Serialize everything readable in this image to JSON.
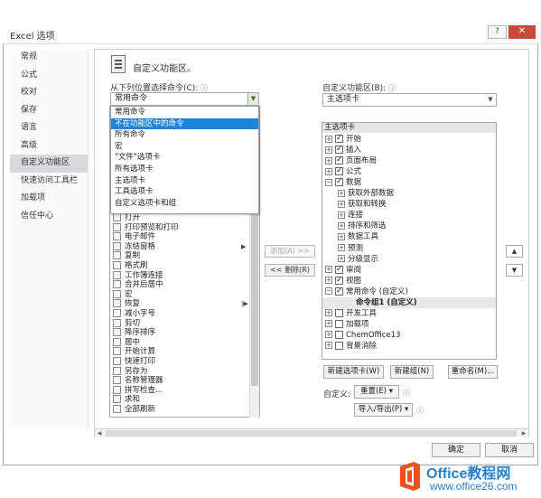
{
  "window": {
    "title": "Excel 选项",
    "help_label": "?",
    "close_label": "✕"
  },
  "nav": [
    "常规",
    "公式",
    "校对",
    "保存",
    "语言",
    "高级",
    "自定义功能区",
    "快速访问工具栏",
    "加载项",
    "信任中心"
  ],
  "nav_active_index": 6,
  "header": {
    "title": "自定义功能区。"
  },
  "left": {
    "label": "从下列位置选择命令(C):",
    "combo_value": "常用命令",
    "dropdown": [
      "常用命令",
      "不在功能区中的命令",
      "所有命令",
      "宏",
      "\"文件\"选项卡",
      "所有选项卡",
      "主选项卡",
      "工具选项卡",
      "自定义选项卡和组"
    ],
    "dropdown_selected_index": 1,
    "commands": [
      {
        "label": "打开",
        "sub": ""
      },
      {
        "label": "打印预览和打印",
        "sub": ""
      },
      {
        "label": "电子邮件",
        "sub": ""
      },
      {
        "label": "冻结窗格",
        "sub": "▶"
      },
      {
        "label": "复制",
        "sub": ""
      },
      {
        "label": "格式刷",
        "sub": ""
      },
      {
        "label": "工作簿连接",
        "sub": ""
      },
      {
        "label": "合并后居中",
        "sub": ""
      },
      {
        "label": "宏",
        "sub": ""
      },
      {
        "label": "恢复",
        "sub": "|▶"
      },
      {
        "label": "减小字号",
        "sub": ""
      },
      {
        "label": "剪切",
        "sub": ""
      },
      {
        "label": "降序排序",
        "sub": ""
      },
      {
        "label": "居中",
        "sub": ""
      },
      {
        "label": "开始计算",
        "sub": ""
      },
      {
        "label": "快速打印",
        "sub": ""
      },
      {
        "label": "另存为",
        "sub": ""
      },
      {
        "label": "名称管理器",
        "sub": ""
      },
      {
        "label": "拼写检查...",
        "sub": ""
      },
      {
        "label": "求和",
        "sub": ""
      },
      {
        "label": "全部刷新",
        "sub": ""
      }
    ]
  },
  "middle": {
    "add_label": "添加(A) >>",
    "remove_label": "<< 删除(R)"
  },
  "right": {
    "label": "自定义功能区(B):",
    "combo_value": "主选项卡",
    "tree_header": "主选项卡",
    "tree": [
      {
        "label": "开始",
        "level": 0,
        "exp": "⊞",
        "check": true,
        "bold": false
      },
      {
        "label": "插入",
        "level": 0,
        "exp": "⊞",
        "check": true,
        "bold": false
      },
      {
        "label": "页面布局",
        "level": 0,
        "exp": "⊞",
        "check": true,
        "bold": false
      },
      {
        "label": "公式",
        "level": 0,
        "exp": "⊞",
        "check": true,
        "bold": false
      },
      {
        "label": "数据",
        "level": 0,
        "exp": "⊟",
        "check": true,
        "bold": false
      },
      {
        "label": "获取外部数据",
        "level": 1,
        "exp": "⊞",
        "check": null,
        "bold": false
      },
      {
        "label": "获取和转换",
        "level": 1,
        "exp": "⊞",
        "check": null,
        "bold": false
      },
      {
        "label": "连接",
        "level": 1,
        "exp": "⊞",
        "check": null,
        "bold": false
      },
      {
        "label": "排序和筛选",
        "level": 1,
        "exp": "⊞",
        "check": null,
        "bold": false
      },
      {
        "label": "数据工具",
        "level": 1,
        "exp": "⊞",
        "check": null,
        "bold": false
      },
      {
        "label": "预测",
        "level": 1,
        "exp": "⊞",
        "check": null,
        "bold": false
      },
      {
        "label": "分级显示",
        "level": 1,
        "exp": "⊞",
        "check": null,
        "bold": false
      },
      {
        "label": "审阅",
        "level": 0,
        "exp": "⊞",
        "check": true,
        "bold": false
      },
      {
        "label": "视图",
        "level": 0,
        "exp": "⊞",
        "check": true,
        "bold": false
      },
      {
        "label": "常用命令 (自定义)",
        "level": 0,
        "exp": "⊟",
        "check": true,
        "bold": false
      },
      {
        "label": "命令组1 (自定义)",
        "level": 2,
        "exp": "",
        "check": null,
        "bold": true
      },
      {
        "label": "开发工具",
        "level": 0,
        "exp": "⊞",
        "check": false,
        "bold": false
      },
      {
        "label": "加载项",
        "level": 0,
        "exp": "⊞",
        "check": false,
        "bold": false
      },
      {
        "label": "ChemOffice13",
        "level": 0,
        "exp": "⊞",
        "check": false,
        "bold": false
      },
      {
        "label": "背景消除",
        "level": 0,
        "exp": "⊞",
        "check": false,
        "bold": false
      }
    ],
    "move_up": "▲",
    "move_down": "▼",
    "new_tab": "新建选项卡(W)",
    "new_group": "新建组(N)",
    "rename": "重命名(M)...",
    "custom_label": "自定义:",
    "reset": "重置(E) ▾",
    "import_export": "导入/导出(P) ▾"
  },
  "footer": {
    "ok": "确定",
    "cancel": "取消"
  },
  "watermark": {
    "brand": "Office教程网",
    "url": "www.office26.com"
  }
}
